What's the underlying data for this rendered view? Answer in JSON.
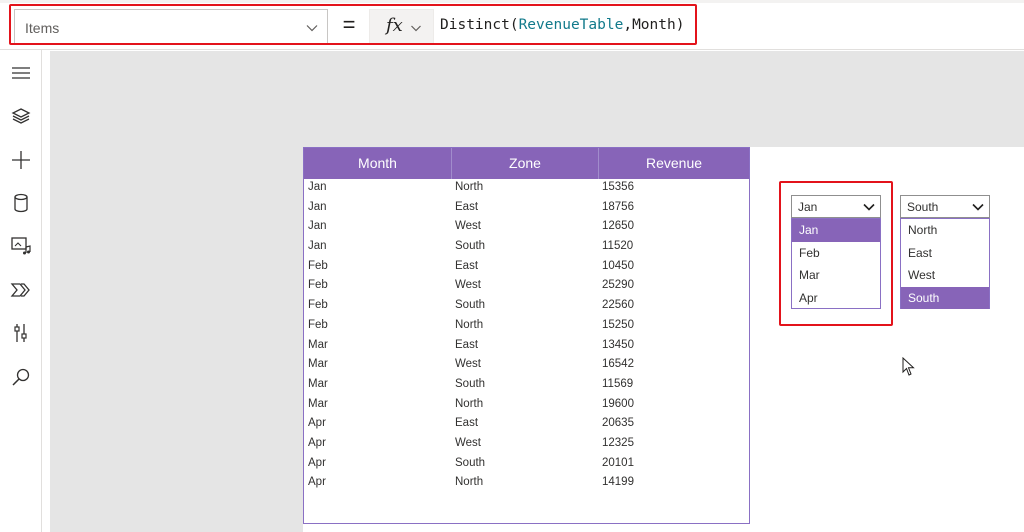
{
  "formula_bar": {
    "property": "Items",
    "equals": "=",
    "fx_label": "fx",
    "formula": {
      "func": "Distinct(",
      "arg1": "RevenueTable",
      "comma": ",",
      "arg2": "Month",
      "close": ")"
    }
  },
  "left_rail": {
    "icons": [
      "menu-icon",
      "layers-icon",
      "add-icon",
      "data-icon",
      "media-icon",
      "power-automate-icon",
      "tools-icon",
      "search-icon"
    ]
  },
  "table": {
    "headers": [
      "Month",
      "Zone",
      "Revenue"
    ],
    "rows": [
      [
        "Jan",
        "North",
        "15356"
      ],
      [
        "Jan",
        "East",
        "18756"
      ],
      [
        "Jan",
        "West",
        "12650"
      ],
      [
        "Jan",
        "South",
        "11520"
      ],
      [
        "Feb",
        "East",
        "10450"
      ],
      [
        "Feb",
        "West",
        "25290"
      ],
      [
        "Feb",
        "South",
        "22560"
      ],
      [
        "Feb",
        "North",
        "15250"
      ],
      [
        "Mar",
        "East",
        "13450"
      ],
      [
        "Mar",
        "West",
        "16542"
      ],
      [
        "Mar",
        "South",
        "11569"
      ],
      [
        "Mar",
        "North",
        "19600"
      ],
      [
        "Apr",
        "East",
        "20635"
      ],
      [
        "Apr",
        "West",
        "12325"
      ],
      [
        "Apr",
        "South",
        "20101"
      ],
      [
        "Apr",
        "North",
        "14199"
      ]
    ]
  },
  "month_dropdown": {
    "value": "Jan",
    "options": [
      "Jan",
      "Feb",
      "Mar",
      "Apr"
    ],
    "selected_index": 0
  },
  "zone_dropdown": {
    "value": "South",
    "options": [
      "North",
      "East",
      "West",
      "South"
    ],
    "selected_index": 3
  },
  "colors": {
    "accent": "#8764b8",
    "highlight_outline": "#e3131b",
    "canvas_bg": "#e5e5e5"
  }
}
